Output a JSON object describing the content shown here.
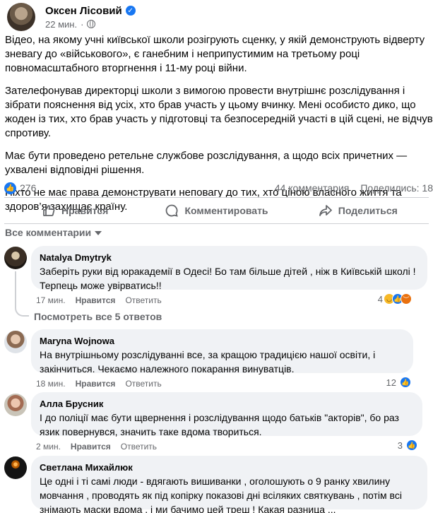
{
  "post": {
    "author": "Оксен Лісовий",
    "time": "22 мин.",
    "paragraphs": [
      "Відео, на якому учні київської школи розігрують сценку, у якій демонструють відверту зневагу до «військового», є ганебним і неприпустимим на третьому році повномасштабного вторгнення і 11-му році війни.",
      "Зателефонував директорці школи з вимогою провести внутрішнє розслідування і зібрати пояснення від усіх, хто брав участь у цьому вчинку. Мені особисто дико, що жоден із тих, хто брав участь у підготовці та безпосередній участі в цій сцені, не відчув спротиву.",
      "Має бути проведено ретельне службове розслідування, а щодо всіх причетних —  ухвалені відповідні рішення.",
      "Ніхто не має права демонструвати неповагу до тих, хто ціною власного життя та здоров’я захищає країну."
    ],
    "reactions_count": "276",
    "comments_count": "44 комментария",
    "shares_count": "Поделились: 18"
  },
  "actions": {
    "like": "Нравится",
    "comment": "Комментировать",
    "share": "Поделиться"
  },
  "comments_filter": "Все комментарии",
  "comments": [
    {
      "name": "Natalya Dmytryk",
      "text": "Заберіть руки від юракадемії в Одесі! Бо там більше дітей , ніж в Київській школі ! Терпець може увірватись!!",
      "time": "17 мин.",
      "like": "Нравится",
      "reply": "Ответить",
      "reactions": "4",
      "replies_link": "Посмотреть все 5 ответов"
    },
    {
      "name": "Maryna Wojnowa",
      "text": "На внутрішньому розслідуванні все, за кращою традицією нашої освіти, і закінчиться. Чекаємо належного покарання винуватців.",
      "time": "18 мин.",
      "like": "Нравится",
      "reply": "Ответить",
      "reactions": "12"
    },
    {
      "name": "Алла Брусник",
      "text": "І до поліції має бути щвернення і розслідування щодо батьків \"акторів\", бо раз язик повернувся, значить таке вдома твориться.",
      "time": "2 мин.",
      "like": "Нравится",
      "reply": "Ответить",
      "reactions": "3"
    },
    {
      "name": "Светлана Михайлюк",
      "text": "Це одні і ті самі люди - вдягають вишиванки , оголошують о 9 ранку хвилину мовчання , проводять як під копірку показові дні всіляких святкувань , потім всі знімають маски вдома , і ми бачимо цей треш ! Какая разница ..."
    }
  ],
  "colors": {
    "accent": "#1877f2",
    "bubble": "#f0f2f5",
    "muted": "#65676b"
  }
}
